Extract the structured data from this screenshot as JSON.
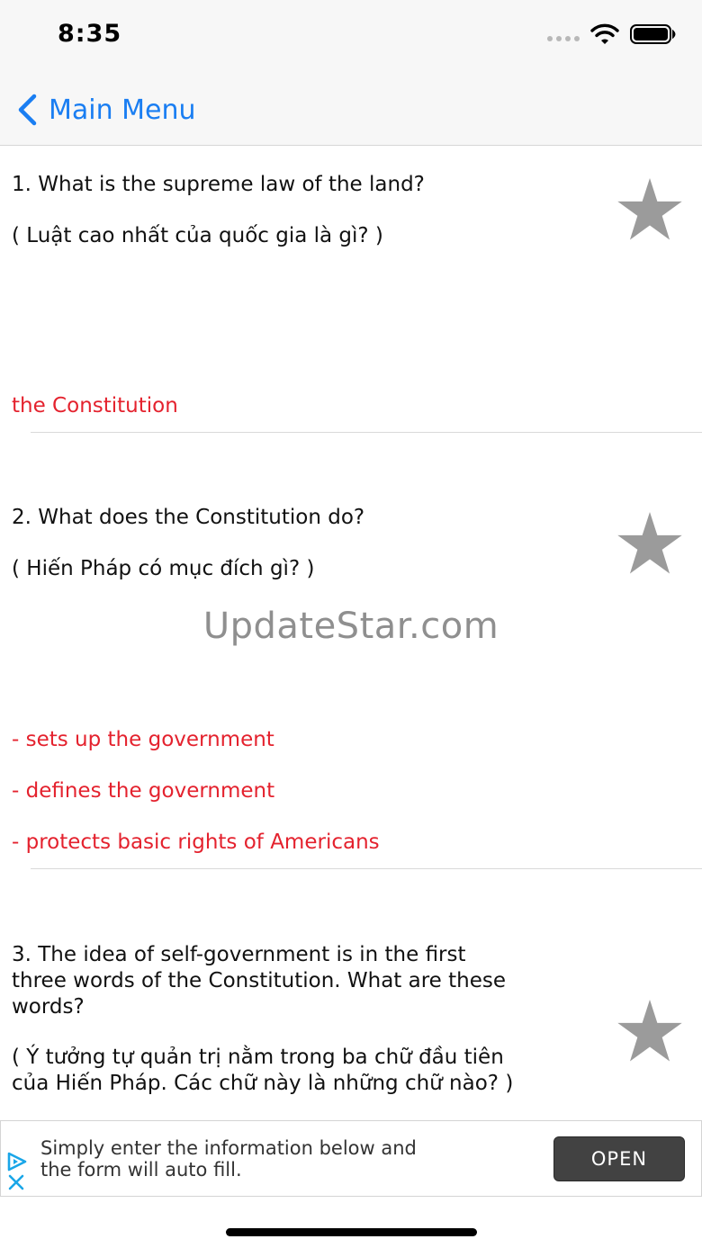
{
  "status": {
    "time": "8:35",
    "icons": [
      "cellular-dots-icon",
      "wifi-icon",
      "battery-icon"
    ]
  },
  "nav": {
    "back_label": "Main Menu",
    "back_icon": "chevron-left-icon",
    "accent": "#1a7ef2"
  },
  "questions": [
    {
      "question_en": "1. What is the supreme law of the land?",
      "question_vi": "( Luật cao nhất của quốc gia là gì? )",
      "answers": [
        "the Constitution"
      ]
    },
    {
      "question_en": "2. What does the Constitution do?",
      "question_vi": "( Hiến Pháp có mục đích gì? )",
      "answers": [
        "- sets up the government",
        "- defines the government",
        "- protects basic rights of Americans"
      ]
    },
    {
      "question_en_lines": [
        "3. The idea of self-government is in the first",
        "three words of the Constitution. What are these",
        "words?"
      ],
      "question_vi_lines": [
        "( Ý tưởng tự quản trị nằm trong ba chữ đầu tiên",
        "của Hiến Pháp. Các chữ này là những chữ nào? )"
      ]
    }
  ],
  "watermark": "UpdateStar.com",
  "ad": {
    "text_lines": [
      "Simply enter the information below and",
      "the form will auto fill."
    ],
    "button_label": "OPEN"
  },
  "colors": {
    "answer": "#e4222e",
    "star": "#9b9b9b",
    "button": "#424242"
  }
}
